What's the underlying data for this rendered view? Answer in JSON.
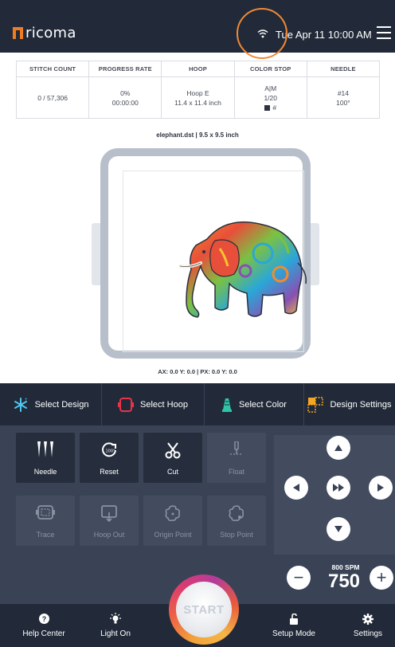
{
  "header": {
    "brand": "ricoma",
    "datetime": "Tue Apr 11 10:00 AM"
  },
  "stats": {
    "stitch_count": {
      "label": "STITCH COUNT",
      "value": "0 / 57,306"
    },
    "progress": {
      "label": "PROGRESS RATE",
      "percent": "0%",
      "time": "00:00:00"
    },
    "hoop": {
      "label": "HOOP",
      "name": "Hoop E",
      "size": "11.4 x 11.4 inch"
    },
    "color_stop": {
      "label": "COLOR STOP",
      "mode": "A|M",
      "count": "1/20",
      "marker": "#"
    },
    "needle": {
      "label": "NEEDLE",
      "number": "#14",
      "angle": "100°"
    }
  },
  "design": {
    "file_info": "elephant.dst  |  9.5 x 9.5 inch",
    "coords": "AX: 0.0  Y: 0.0  |  PX: 0.0  Y: 0.0"
  },
  "toolbar": {
    "select_design": "Select Design",
    "select_hoop": "Select Hoop",
    "select_color": "Select Color",
    "design_settings": "Design Settings"
  },
  "controls": {
    "needle": "Needle",
    "reset": "Reset",
    "cut": "Cut",
    "float": "Float",
    "trace": "Trace",
    "hoop_out": "Hoop Out",
    "origin_point": "Origin Point",
    "stop_point": "Stop Point"
  },
  "speed": {
    "label": "800 SPM",
    "value": "750",
    "minus": "−",
    "plus": "+"
  },
  "start_label": "START",
  "bottom": {
    "help_center": "Help Center",
    "light_on": "Light On",
    "setup_mode": "Setup Mode",
    "settings": "Settings"
  },
  "colors": {
    "header_bg": "#222a39",
    "panel_bg": "#3a4356",
    "accent_orange": "#ef8a35"
  }
}
